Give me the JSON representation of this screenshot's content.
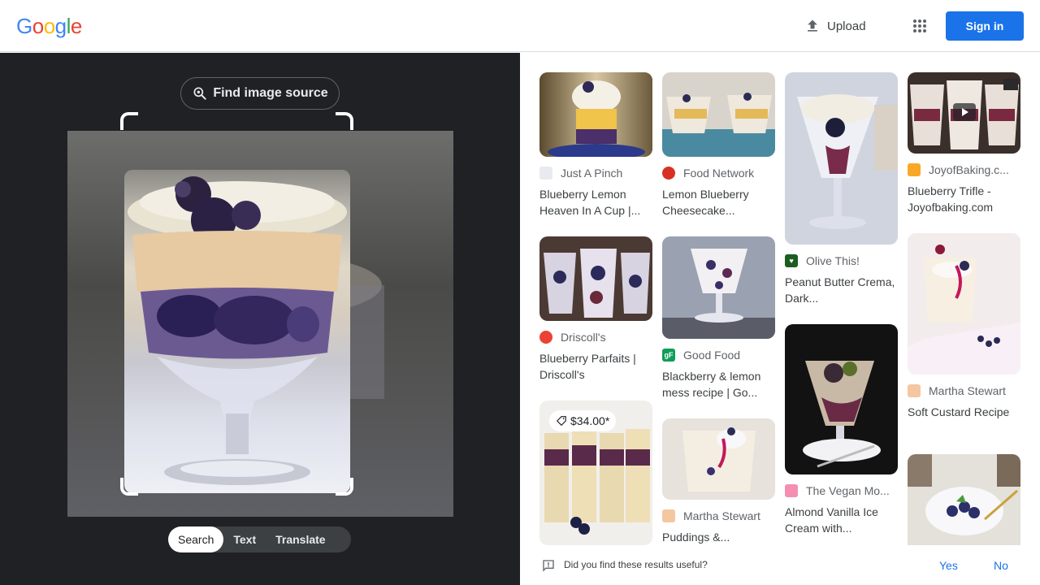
{
  "header": {
    "logo_letters": [
      {
        "ch": "G",
        "color": "#4285f4"
      },
      {
        "ch": "o",
        "color": "#ea4335"
      },
      {
        "ch": "o",
        "color": "#fbbc05"
      },
      {
        "ch": "g",
        "color": "#4285f4"
      },
      {
        "ch": "l",
        "color": "#34a853"
      },
      {
        "ch": "e",
        "color": "#ea4335"
      }
    ],
    "upload_label": "Upload",
    "apps_icon": "apps-grid-icon",
    "signin_label": "Sign in"
  },
  "lens": {
    "find_source_label": "Find image source",
    "modes": [
      "Search",
      "Text",
      "Translate"
    ],
    "active_mode": "Search"
  },
  "results": [
    {
      "source": "Just A Pinch",
      "title": "Blueberry Lemon Heaven In A Cup |...",
      "fav_color": "#e8eaf0",
      "fav_glyph": ""
    },
    {
      "source": "Food Network",
      "title": "Lemon Blueberry Cheesecake...",
      "fav_color": "#d93025",
      "fav_glyph": "food"
    },
    {
      "source": "Olive This!",
      "title": "Peanut Butter Crema, Dark...",
      "fav_color": "#1b5e20",
      "fav_glyph": "♥"
    },
    {
      "source": "JoyofBaking.c...",
      "title": "Blueberry Trifle - Joyofbaking.com",
      "fav_color": "#f9a825",
      "fav_glyph": ""
    },
    {
      "source": "Driscoll's",
      "title": "Blueberry Parfaits | Driscoll's",
      "fav_color": "#ea4335",
      "fav_glyph": ""
    },
    {
      "source": "Good Food",
      "title": "Blackberry & lemon mess recipe | Go...",
      "fav_color": "#0f9d58",
      "fav_glyph": "gF"
    },
    {
      "source": "The Vegan Mo...",
      "title": "Almond Vanilla Ice Cream with...",
      "fav_color": "#f48fb1",
      "fav_glyph": ""
    },
    {
      "source": "Martha Stewart",
      "title": "Soft Custard Recipe",
      "fav_color": "#f4c7a1",
      "fav_glyph": ""
    },
    {
      "source": "Martha Stewart",
      "title": "Puddings &...",
      "fav_color": "#f4c7a1",
      "fav_glyph": ""
    }
  ],
  "price_badge": "$34.00*",
  "feedback": {
    "question": "Did you find these results useful?",
    "yes": "Yes",
    "no": "No"
  }
}
